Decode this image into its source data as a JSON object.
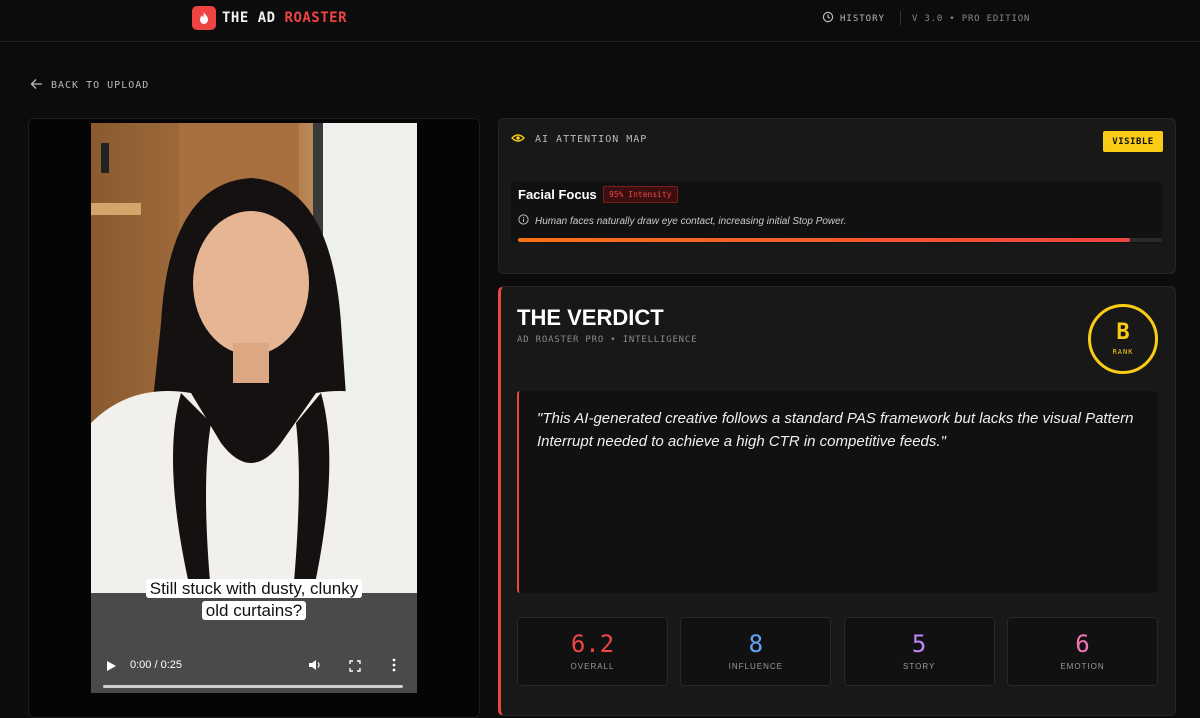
{
  "header": {
    "brand_white": "THE AD",
    "brand_red": "ROASTER",
    "history_label": "HISTORY",
    "version": "V 3.0 • PRO EDITION"
  },
  "nav": {
    "back_label": "BACK TO UPLOAD"
  },
  "video": {
    "caption_line1": "Still stuck with dusty, clunky",
    "caption_line2": "old curtains?",
    "time": "0:00 / 0:25",
    "progress": 0
  },
  "attention": {
    "title": "AI ATTENTION MAP",
    "visible_label": "VISIBLE",
    "focus_title": "Facial Focus",
    "focus_badge": "95% Intensity",
    "focus_note": "Human faces naturally draw eye contact, increasing initial Stop Power.",
    "intensity": 0.95
  },
  "verdict": {
    "title": "THE VERDICT",
    "subtitle": "AD ROASTER PRO • INTELLIGENCE",
    "rank_letter": "B",
    "rank_label": "RANK",
    "quote": "\"This AI-generated creative follows a standard PAS framework but lacks the visual Pattern Interrupt needed to achieve a high CTR in competitive feeds.\"",
    "metrics": [
      {
        "value": "6.2",
        "label": "OVERALL",
        "color": "#ef4444"
      },
      {
        "value": "8",
        "label": "INFLUENCE",
        "color": "#60a5fa"
      },
      {
        "value": "5",
        "label": "STORY",
        "color": "#c084fc"
      },
      {
        "value": "6",
        "label": "EMOTION",
        "color": "#f472b6"
      }
    ]
  },
  "colors": {
    "accent": "#ef4444",
    "highlight": "#facc15",
    "background": "#0c0c0c"
  }
}
